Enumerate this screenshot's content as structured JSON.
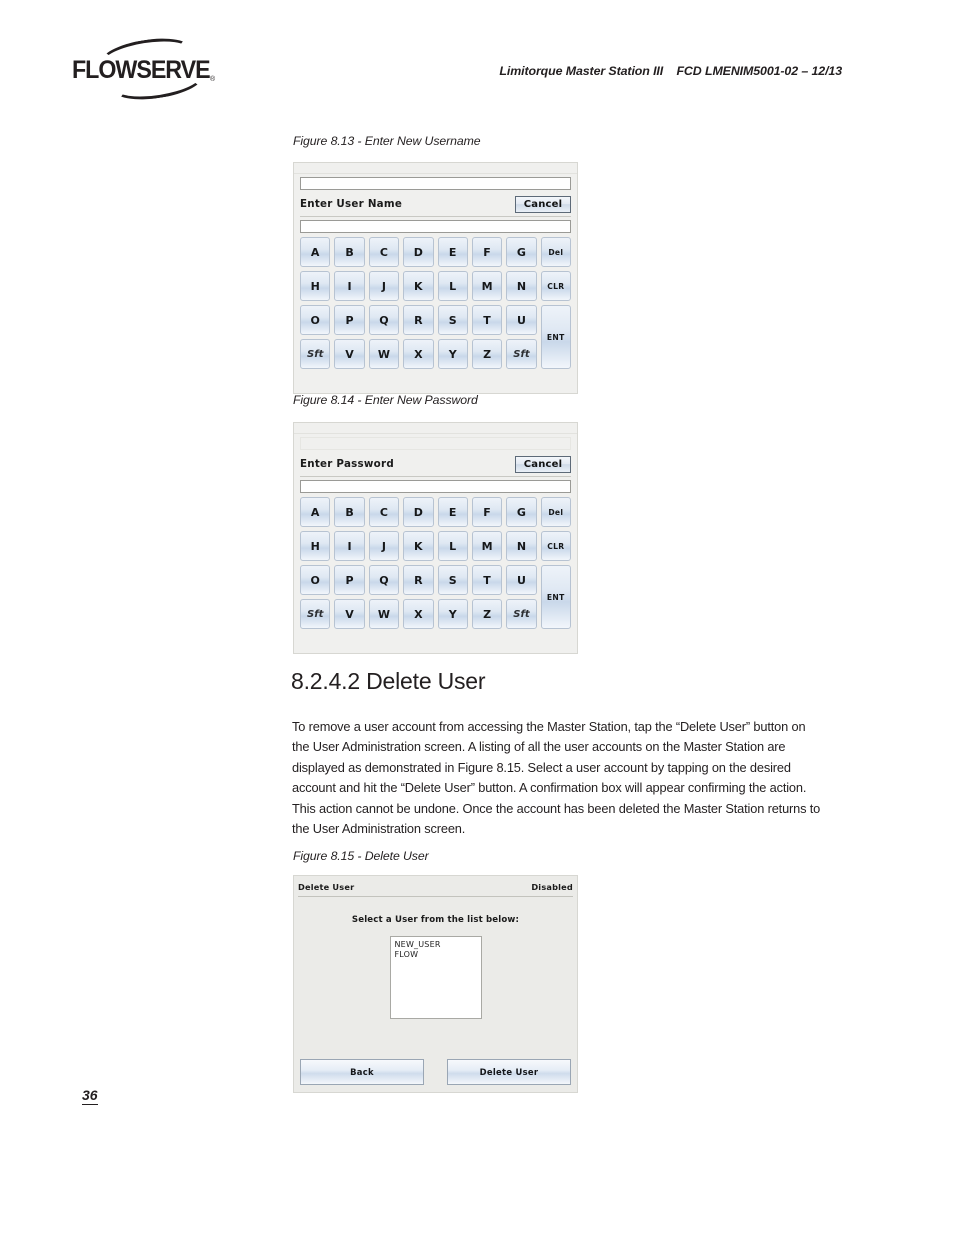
{
  "header": {
    "logo_text": "FLOWSERVE",
    "logo_registered": "®",
    "doc_reference": "Limitorque Master Station III    FCD LMENIM5001-02 – 12/13"
  },
  "figures": [
    {
      "caption": "Figure 8.13 - Enter New Username",
      "screen": {
        "label": "Enter User Name",
        "cancel_label": "Cancel",
        "input_value": "",
        "top_input_style": "bordered"
      }
    },
    {
      "caption": "Figure 8.14 - Enter New Password",
      "screen": {
        "label": "Enter Password",
        "cancel_label": "Cancel",
        "input_value": "",
        "top_input_style": "flat"
      }
    },
    {
      "caption": "Figure 8.15 - Delete User"
    }
  ],
  "keyboard": {
    "rows": [
      [
        "A",
        "B",
        "C",
        "D",
        "E",
        "F",
        "G",
        "Del"
      ],
      [
        "H",
        "I",
        "J",
        "K",
        "L",
        "M",
        "N",
        "CLR"
      ],
      [
        "O",
        "P",
        "Q",
        "R",
        "S",
        "T",
        "U",
        "ENT"
      ],
      [
        "Sft",
        "V",
        "W",
        "X",
        "Y",
        "Z",
        "Sft"
      ]
    ]
  },
  "section": {
    "number_title": "8.2.4.2 Delete User",
    "body": "To remove a user account from accessing the Master Station, tap the “Delete User” button on the User Administration screen. A listing of all the user accounts on the Master Station are displayed as demonstrated in Figure 8.15. Select a user account by tapping on the desired account and hit the “Delete User” button. A confirmation box will appear confirming the action. This action cannot be undone. Once the account has been deleted the Master Station returns to the User Administration screen."
  },
  "delete_user_screen": {
    "title": "Delete User",
    "status": "Disabled",
    "prompt": "Select a User from the list below:",
    "user_list": [
      "NEW_USER",
      "FLOW"
    ],
    "back_label": "Back",
    "delete_label": "Delete User"
  },
  "footer": {
    "page_number": "36"
  }
}
